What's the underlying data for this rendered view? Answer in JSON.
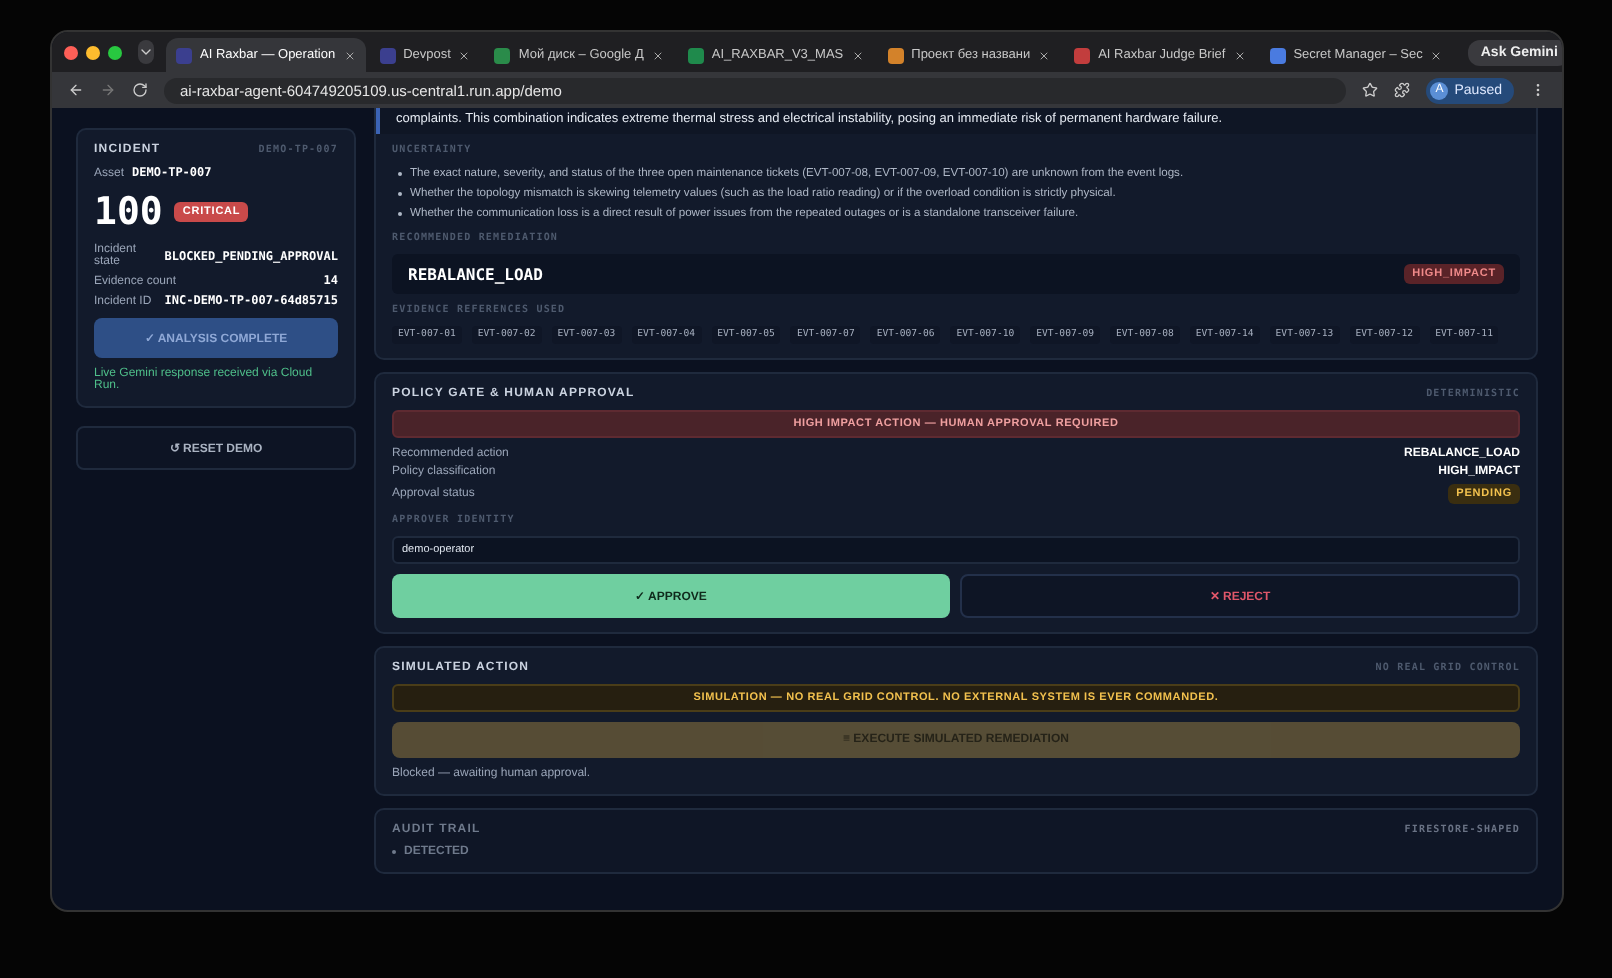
{
  "browser": {
    "tabs": [
      {
        "title": "AI Raxbar — Operation",
        "selected": true
      },
      {
        "title": "Devpost",
        "selected": false
      },
      {
        "title": "Мой диск – Google Д",
        "selected": false
      },
      {
        "title": "AI_RAXBAR_V3_MAS",
        "selected": false
      },
      {
        "title": "Проект без названи",
        "selected": false
      },
      {
        "title": "AI Raxbar Judge Brief",
        "selected": false
      },
      {
        "title": "Secret Manager – Sec",
        "selected": false
      }
    ],
    "ask_button": "Ask Gemini",
    "url": "ai-raxbar-agent-604749205109.us-central1.run.app/demo",
    "profile": {
      "initial": "A",
      "label": "Paused"
    }
  },
  "incident": {
    "title": "INCIDENT",
    "code": "DEMO-TP-007",
    "asset_label": "Asset",
    "asset": "DEMO-TP-007",
    "score": "100",
    "severity": "CRITICAL",
    "fields": [
      {
        "label": "Incident state",
        "value": "BLOCKED_PENDING_APPROVAL"
      },
      {
        "label": "Evidence count",
        "value": "14"
      },
      {
        "label": "Incident ID",
        "value": "INC-DEMO-TP-007-64d85715"
      }
    ],
    "analysis_button": "✓ ANALYSIS COMPLETE",
    "status": "Live Gemini response received via Cloud Run.",
    "reset_button": "↺ RESET DEMO"
  },
  "analysis": {
    "summary": "complaints. This combination indicates extreme thermal stress and electrical instability, posing an immediate risk of permanent hardware failure.",
    "uncertainty_title": "UNCERTAINTY",
    "uncertainty": [
      "The exact nature, severity, and status of the three open maintenance tickets (EVT-007-08, EVT-007-09, EVT-007-10) are unknown from the event logs.",
      "Whether the topology mismatch is skewing telemetry values (such as the load ratio reading) or if the overload condition is strictly physical.",
      "Whether the communication loss is a direct result of power issues from the repeated outages or is a standalone transceiver failure."
    ],
    "remediation_title": "RECOMMENDED REMEDIATION",
    "remediation": "REBALANCE_LOAD",
    "impact": "HIGH_IMPACT",
    "evidence_title": "EVIDENCE REFERENCES USED",
    "evidence": [
      "EVT-007-01",
      "EVT-007-02",
      "EVT-007-03",
      "EVT-007-04",
      "EVT-007-05",
      "EVT-007-07",
      "EVT-007-06",
      "EVT-007-10",
      "EVT-007-09",
      "EVT-007-08",
      "EVT-007-14",
      "EVT-007-13",
      "EVT-007-12",
      "EVT-007-11"
    ]
  },
  "policy": {
    "title": "POLICY GATE & HUMAN APPROVAL",
    "tag": "DETERMINISTIC",
    "alert": "HIGH IMPACT ACTION — HUMAN APPROVAL REQUIRED",
    "rows": [
      {
        "label": "Recommended action",
        "value": "REBALANCE_LOAD",
        "kind": "text"
      },
      {
        "label": "Policy classification",
        "value": "HIGH_IMPACT",
        "kind": "text"
      },
      {
        "label": "Approval status",
        "value": "PENDING",
        "kind": "badge"
      }
    ],
    "approver_label": "APPROVER IDENTITY",
    "approver": "demo-operator",
    "approve": "✓ APPROVE",
    "reject": "✕ REJECT"
  },
  "simulation": {
    "title": "SIMULATED ACTION",
    "tag": "NO REAL GRID CONTROL",
    "warning": "SIMULATION — NO REAL GRID CONTROL. NO EXTERNAL SYSTEM IS EVER COMMANDED.",
    "execute": "≡ EXECUTE SIMULATED REMEDIATION",
    "execute_disabled": true,
    "note": "Blocked — awaiting human approval."
  },
  "audit": {
    "title": "AUDIT TRAIL",
    "tag": "FIRESTORE-SHAPED",
    "entries": [
      "DETECTED"
    ]
  }
}
